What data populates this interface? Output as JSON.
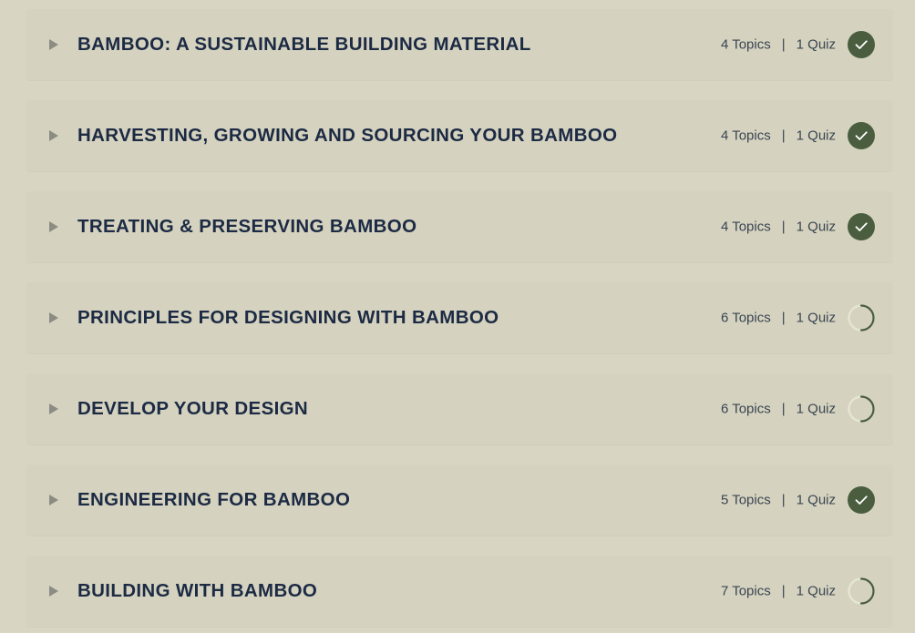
{
  "colors": {
    "background": "#d8d6c3",
    "row_background": "#d5d3bf",
    "title_text": "#1c2a44",
    "meta_text": "#3a4452",
    "complete_badge": "#4a5e3f",
    "caret": "#8d8c84"
  },
  "separator": "|",
  "modules": [
    {
      "title": "BAMBOO: A SUSTAINABLE BUILDING MATERIAL",
      "topics": "4 Topics",
      "quizzes": "1 Quiz",
      "status": "complete"
    },
    {
      "title": "HARVESTING, GROWING AND SOURCING YOUR BAMBOO",
      "topics": "4 Topics",
      "quizzes": "1 Quiz",
      "status": "complete"
    },
    {
      "title": "TREATING & PRESERVING BAMBOO",
      "topics": "4 Topics",
      "quizzes": "1 Quiz",
      "status": "complete"
    },
    {
      "title": "PRINCIPLES FOR DESIGNING WITH BAMBOO",
      "topics": "6 Topics",
      "quizzes": "1 Quiz",
      "status": "in-progress"
    },
    {
      "title": "DEVELOP YOUR DESIGN",
      "topics": "6 Topics",
      "quizzes": "1 Quiz",
      "status": "in-progress"
    },
    {
      "title": "ENGINEERING FOR BAMBOO",
      "topics": "5 Topics",
      "quizzes": "1 Quiz",
      "status": "complete"
    },
    {
      "title": "BUILDING WITH BAMBOO",
      "topics": "7 Topics",
      "quizzes": "1 Quiz",
      "status": "in-progress"
    }
  ]
}
